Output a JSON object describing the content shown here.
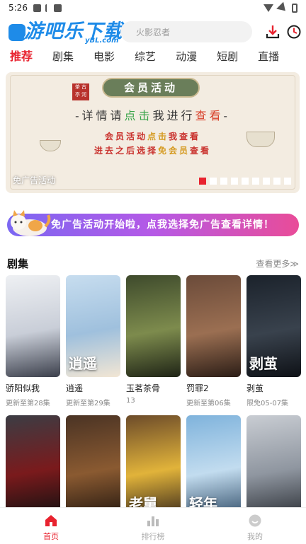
{
  "status_bar": {
    "time": "5:26"
  },
  "header": {
    "logo_text": "游吧乐下载",
    "logo_sub": "yBL.com",
    "search_placeholder": "火影忍者"
  },
  "tabs": [
    {
      "label": "推荐",
      "active": true
    },
    {
      "label": "剧集"
    },
    {
      "label": "电影"
    },
    {
      "label": "综艺"
    },
    {
      "label": "动漫"
    },
    {
      "label": "短剧"
    },
    {
      "label": "直播"
    }
  ],
  "banner": {
    "seal_text": "茶 古 亭 河",
    "title": "会员活动",
    "line1": {
      "a": "-详情请",
      "b": "点击",
      "c": "我进行",
      "d": "查看",
      "e": "-"
    },
    "line2": {
      "a": "会员活动",
      "b": "点击",
      "c": "我查看"
    },
    "line3": {
      "a": "进去之后选择",
      "b": "免会员",
      "c": "查看"
    },
    "caption": "免广告活动",
    "dot_count": 9,
    "active_dot": 0
  },
  "promo": {
    "text": "免广告活动开始啦，点我选择免广告查看详情！"
  },
  "section": {
    "title": "剧集",
    "more": "查看更多≫"
  },
  "row1": [
    {
      "title": "骄阳似我",
      "sub": "更新至第28集",
      "poster_text": "",
      "colors": [
        "#eef0f3",
        "#c9ced8",
        "#3b3f4b"
      ]
    },
    {
      "title": "逍遥",
      "sub": "更新至第29集",
      "poster_text": "逍遥",
      "colors": [
        "#c7ddef",
        "#9fc0dd",
        "#f2e6d4"
      ]
    },
    {
      "title": "玉茗茶骨",
      "sub": "13",
      "poster_text": "",
      "colors": [
        "#3e4a2c",
        "#7d8b4d",
        "#1f2416"
      ]
    },
    {
      "title": "罚罪2",
      "sub": "更新至第06集",
      "poster_text": "",
      "colors": [
        "#6b4b3a",
        "#9b6f52",
        "#2b1d16"
      ]
    },
    {
      "title": "剥茧",
      "sub": "限免05-07集",
      "poster_text": "剥茧",
      "colors": [
        "#1b222b",
        "#39424d",
        "#0e1116"
      ]
    }
  ],
  "row2": [
    {
      "poster_text": "",
      "colors": [
        "#3b3d44",
        "#7a1a1c",
        "#111"
      ]
    },
    {
      "poster_text": "",
      "colors": [
        "#4a3324",
        "#8a5a31",
        "#241810"
      ]
    },
    {
      "poster_text": "老舅",
      "colors": [
        "#6c4b2a",
        "#e1b33a",
        "#3a2a1c"
      ]
    },
    {
      "poster_text": "轻年",
      "colors": [
        "#7fb3dc",
        "#c2dcef",
        "#34506b"
      ]
    },
    {
      "poster_text": "",
      "colors": [
        "#c9cdd3",
        "#8f96a0",
        "#2e3238"
      ]
    }
  ],
  "bottom_nav": [
    {
      "label": "首页",
      "active": true,
      "icon": "home-icon"
    },
    {
      "label": "排行榜",
      "icon": "ranking-icon"
    },
    {
      "label": "我的",
      "icon": "profile-icon"
    }
  ]
}
